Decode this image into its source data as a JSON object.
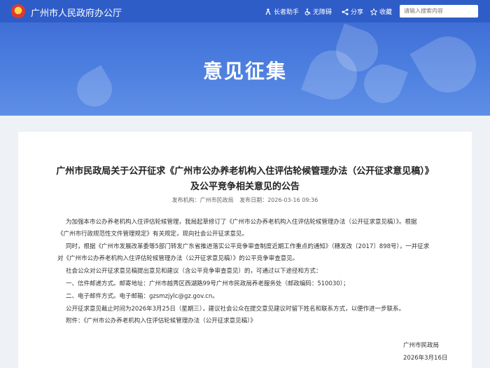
{
  "header": {
    "site_title": "广州市人民政府办公厅",
    "tools": {
      "elderly": "长者助手",
      "accessibility": "无障碍",
      "share": "分享",
      "favorite": "收藏"
    },
    "search_placeholder": "请输入搜索内容"
  },
  "banner": {
    "title": "意见征集"
  },
  "article": {
    "title_line1": "广州市民政局关于公开征求《广州市公办养老机构入住评估轮候管理办法（公开征求意见稿）》",
    "title_line2": "及公平竞争相关意见的公告",
    "meta": {
      "publisher": "发布机构：广州市民政局",
      "date": "发布日期：2026-03-16 09:36"
    },
    "paragraphs": [
      "为加强本市公办养老机构入住评估轮候管理，我局起草修订了《广州市公办养老机构入住评估轮候管理办法（公开征求意见稿）》。根据",
      "《广州市行政规范性文件管理规定》有关规定，现向社会公开征求意见。",
      "同时，根据《广州市发展改革委等5部门转发广东省推进落实公平竞争审查制度近期工作重点的通知》（穗发改〔2017〕898号），一并征求",
      "对《广州市公办养老机构入住评估轮候管理办法（公开征求意见稿）》的公平竞争审查意见。",
      "社会公众对公开征求意见稿提出意见和建议（含公平竞争审查意见）的，可通过以下途径和方式：",
      "一、信件邮递方式。邮寄地址：广州市越秀区西湖路99号广州市民政局养老服务处（邮政编码：510030）；",
      "二、电子邮件方式。电子邮箱：gzsmzjylc@gz.gov.cn。",
      "公开征求意见截止时间为2026年3月25日（星期三），建议社会公众在提交意见建议时留下姓名和联系方式，以便作进一步联系。",
      "附件：《广州市公办养老机构入住评估轮候管理办法（公开征求意见稿）》"
    ],
    "signature": "广州市民政局",
    "sign_date": "2026年3月16日"
  },
  "colors": {
    "header_bg": "#2f5dc8",
    "banner_bg": "#4d7fe0",
    "page_bg": "#eef1f5"
  }
}
